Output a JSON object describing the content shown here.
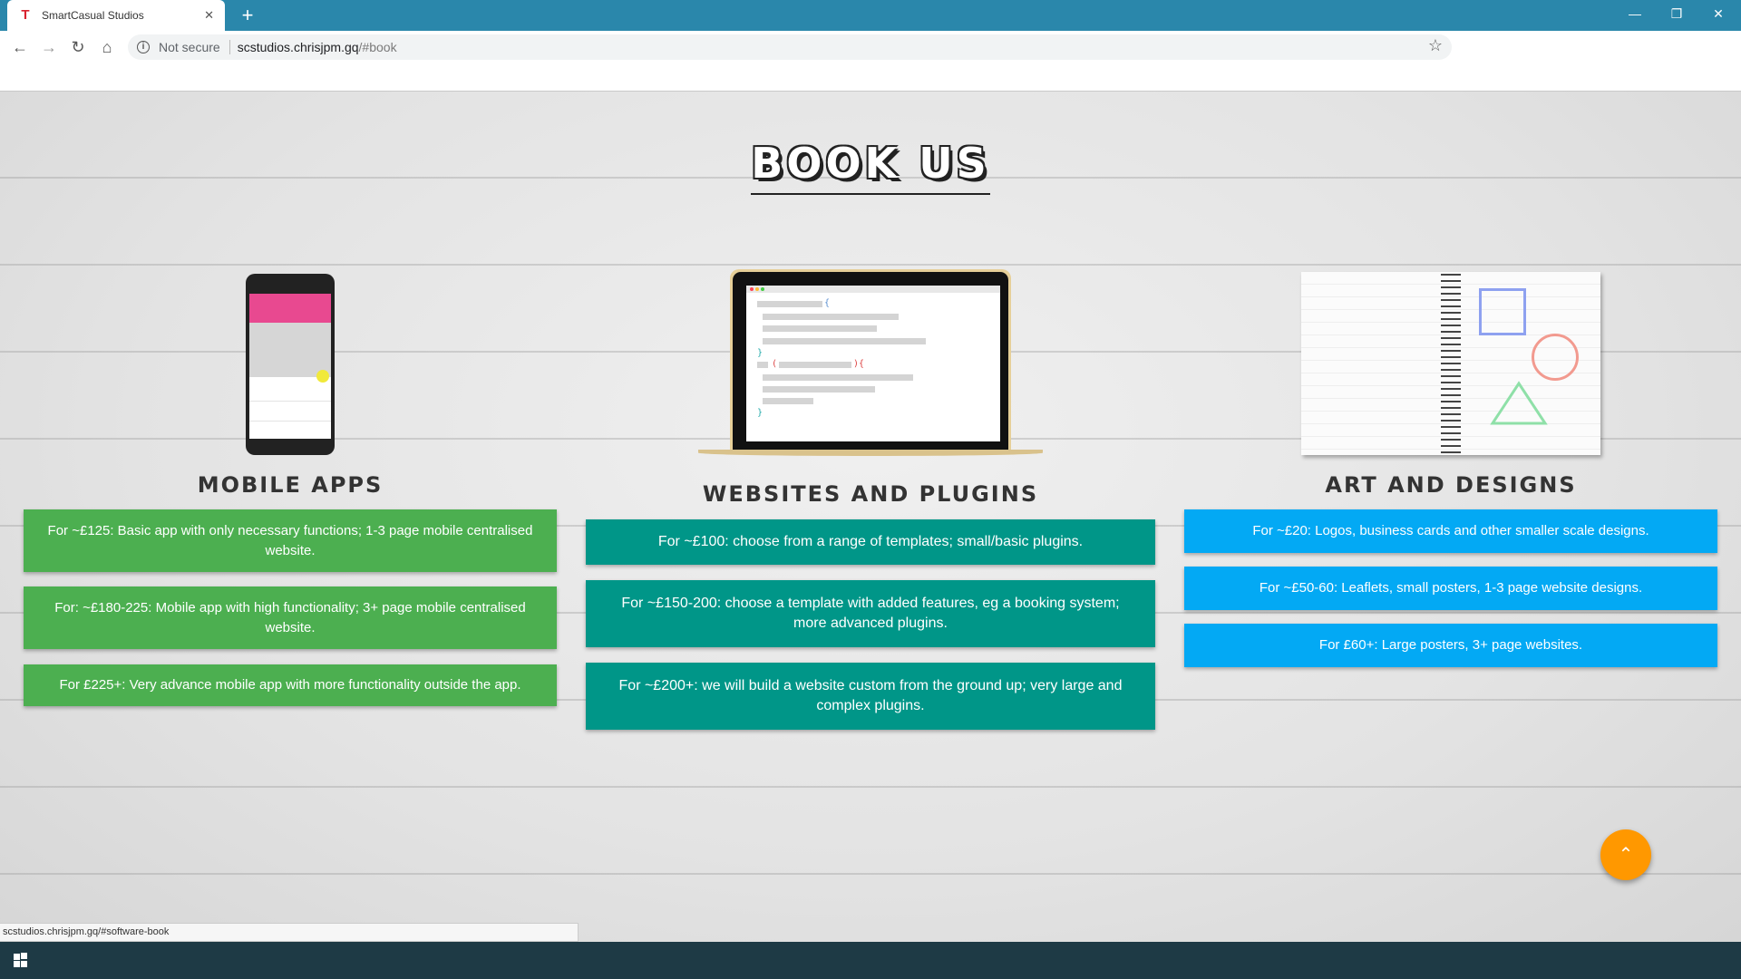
{
  "browser": {
    "tab_title": "SmartCasual Studios",
    "tab_favicon": "T",
    "new_tab": "+",
    "not_secure": "Not secure",
    "url_host": "scstudios.chrisjpm.gq",
    "url_hash": "/#book",
    "status_url": "scstudios.chrisjpm.gq/#software-book"
  },
  "page": {
    "heading": "Book Us",
    "columns": [
      {
        "title": "Mobile Apps",
        "items": [
          "For ~£125: Basic app with only necessary functions; 1-3 page mobile centralised website.",
          "For: ~£180-225: Mobile app with high functionality; 3+ page mobile centralised website.",
          "For £225+: Very advance mobile app with more functionality outside the app."
        ],
        "color": "#4caf50"
      },
      {
        "title": "Websites and Plugins",
        "items": [
          "For ~£100: choose from a range of templates; small/basic plugins.",
          "For ~£150-200: choose a template with added features, eg a booking system; more advanced plugins.",
          "For ~£200+: we will build a website custom from the ground up; very large and complex plugins."
        ],
        "color": "#009688"
      },
      {
        "title": "Art and Designs",
        "items": [
          "For ~£20: Logos, business cards and other smaller scale designs.",
          "For ~£50-60: Leaflets, small posters, 1-3 page website designs.",
          "For £60+: Large posters, 3+ page websites."
        ],
        "color": "#03a9f4"
      }
    ]
  },
  "icons": {
    "back": "back-arrow-icon",
    "forward": "forward-arrow-icon",
    "reload": "reload-icon",
    "home": "home-icon",
    "star": "star-icon",
    "scroll_top": "chevron-up-icon"
  }
}
